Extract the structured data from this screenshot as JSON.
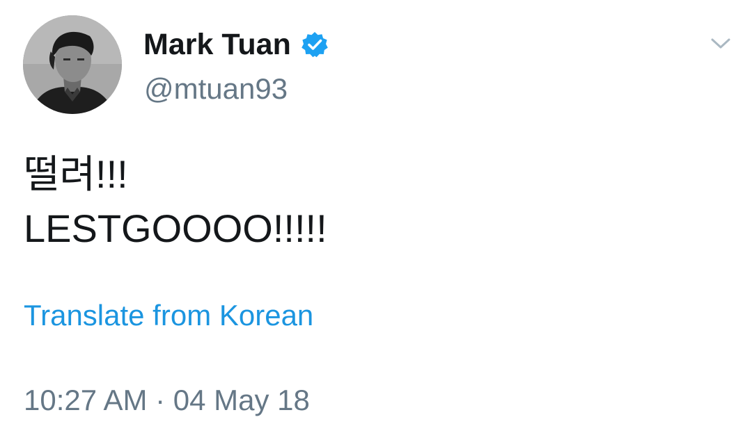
{
  "author": {
    "display_name": "Mark Tuan",
    "handle": "@mtuan93",
    "verified": true
  },
  "tweet": {
    "lines": [
      "떨려!!!",
      "LESTGOOOO!!!!!"
    ],
    "translate_label": "Translate from Korean",
    "timestamp": "10:27 AM · 04 May 18"
  },
  "icons": {
    "verified": "verified-badge-icon",
    "menu": "chevron-down-icon"
  },
  "colors": {
    "text": "#14171a",
    "secondary": "#657786",
    "link": "#1b95e0",
    "verified": "#1da1f2",
    "chevron": "#aab8c2"
  }
}
